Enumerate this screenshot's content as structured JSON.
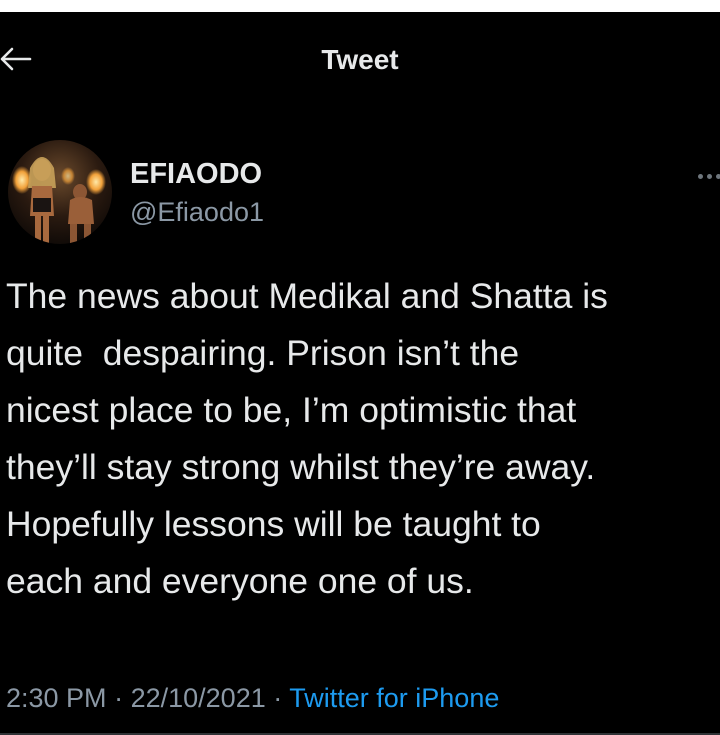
{
  "header": {
    "title": "Tweet",
    "back_icon": "arrow-left-icon"
  },
  "author": {
    "display_name": "EFIAODO",
    "handle": "@Efiaodo1",
    "avatar": "profile-photo",
    "more_icon": "more-dots-icon"
  },
  "tweet": {
    "lines": [
      "The news about Medikal and Shatta is",
      "quite  despairing. Prison isn’t the",
      "nicest place to be, I’m optimistic that",
      "they’ll stay strong whilst they’re away.",
      "Hopefully lessons will be taught to",
      "each and everyone one of us."
    ]
  },
  "meta": {
    "time": "2:30 PM",
    "separator": "·",
    "date": "22/10/2021",
    "source": "Twitter for iPhone"
  },
  "colors": {
    "background": "#000000",
    "text": "#e7e9ea",
    "secondary": "#8b98a5",
    "link": "#1d9bf0"
  }
}
